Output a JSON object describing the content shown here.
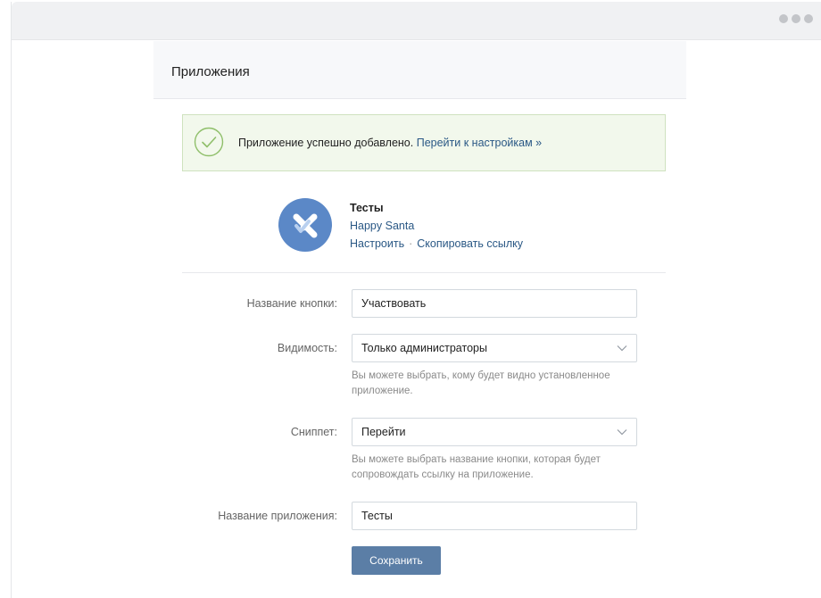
{
  "window": {
    "menu_icon": "more-dots-icon"
  },
  "header": {
    "title": "Приложения"
  },
  "alert": {
    "icon": "check-circle-icon",
    "message": "Приложение успешно добавлено.",
    "link": "Перейти к настройкам »"
  },
  "app": {
    "icon": "app-logo-icon",
    "title": "Тесты",
    "author": "Happy Santa",
    "configure_link": "Настроить",
    "separator": "·",
    "copy_link": "Скопировать ссылку"
  },
  "form": {
    "button_name": {
      "label": "Название кнопки:",
      "value": "Участвовать"
    },
    "visibility": {
      "label": "Видимость:",
      "value": "Только администраторы",
      "hint": "Вы можете выбрать, кому будет видно установленное приложение."
    },
    "snippet": {
      "label": "Сниппет:",
      "value": "Перейти",
      "hint": "Вы можете выбрать название кнопки, которая будет сопровождать ссылку на приложение."
    },
    "app_name": {
      "label": "Название приложения:",
      "value": "Тесты"
    },
    "save_label": "Сохранить"
  },
  "colors": {
    "accent": "#5b7ea6",
    "link": "#2a5885",
    "success_bg": "#f2f8ec",
    "success_border": "#cfe2bf",
    "avatar": "#5b88c7"
  }
}
